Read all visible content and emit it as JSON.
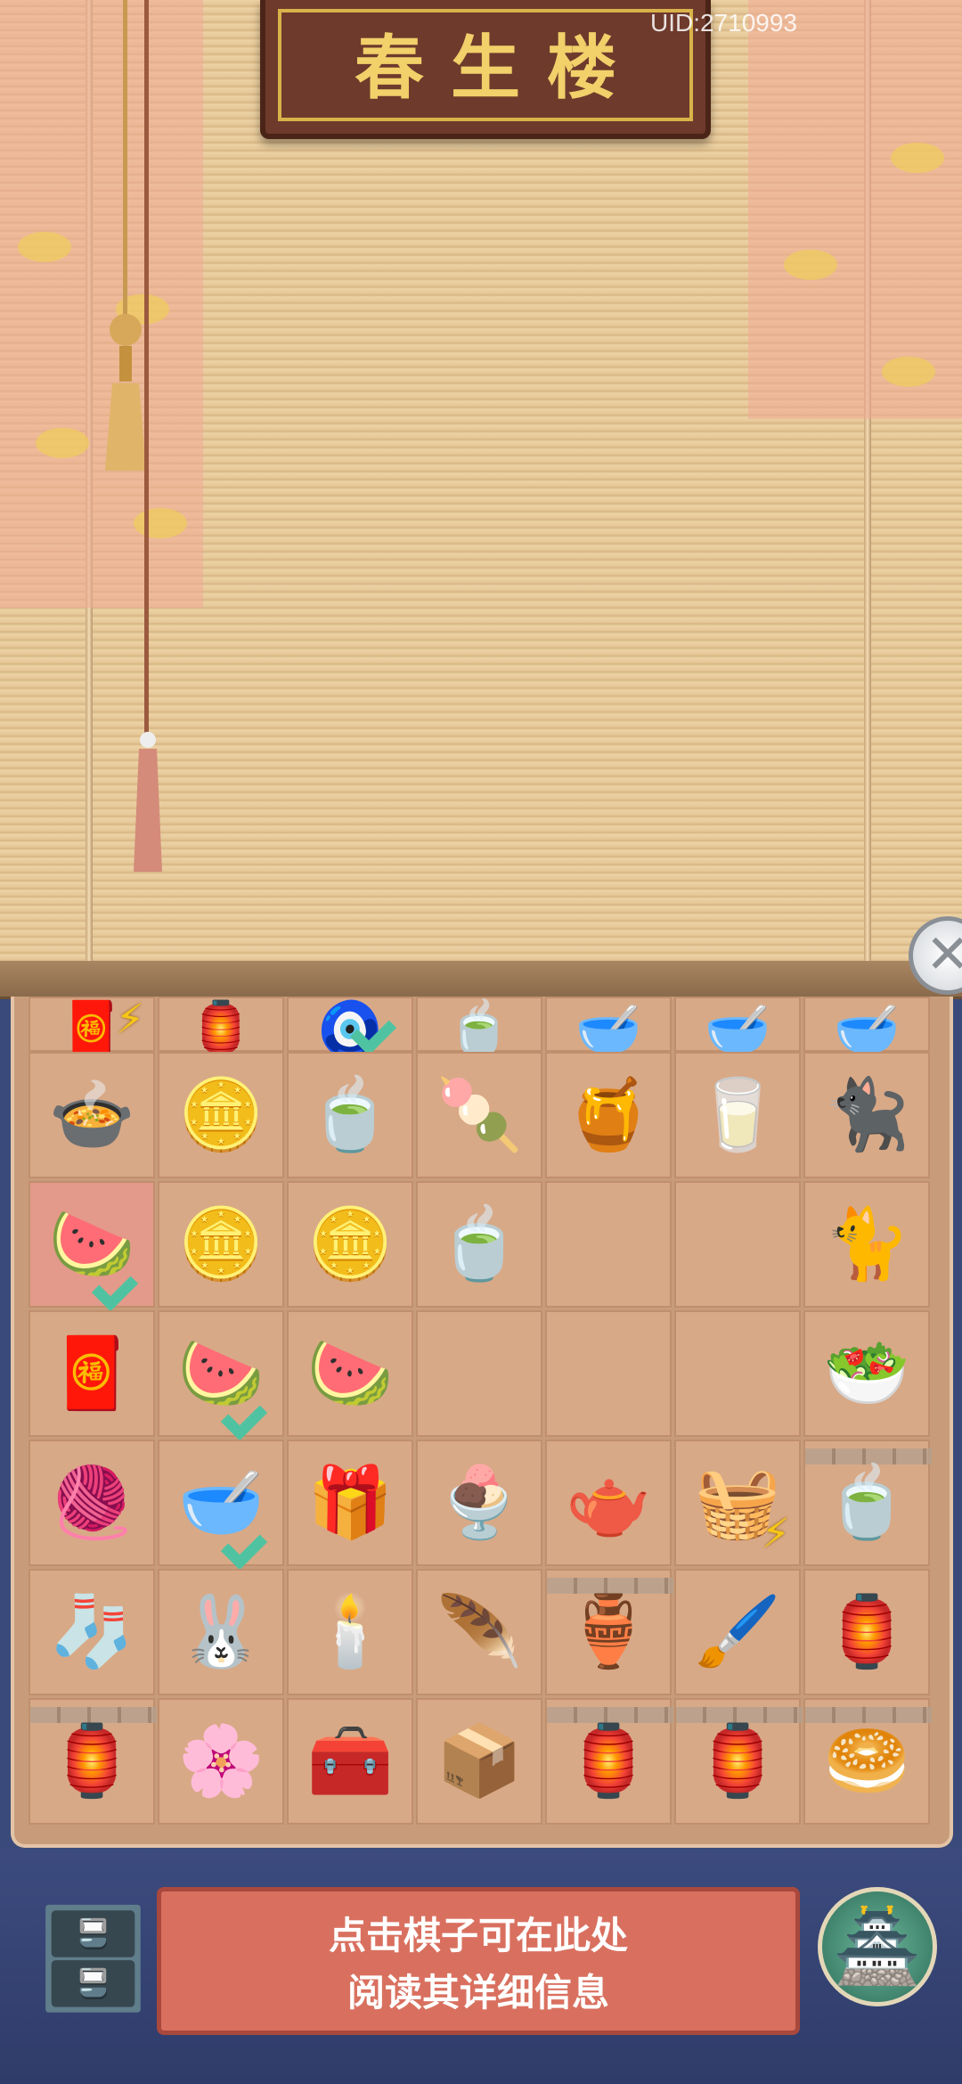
{
  "header": {
    "sign_title": "春生楼",
    "uid": "UID:2710993"
  },
  "icons": {
    "close": "close-x-icon",
    "storage": "cabinet-icon",
    "shop": "pavilion-icon"
  },
  "board": {
    "partial_row": [
      {
        "item": "🧧",
        "name": "partial-item-pouch",
        "bolt": true
      },
      {
        "item": "🏮",
        "name": "partial-item-lantern-purple"
      },
      {
        "item": "🧿",
        "name": "partial-item-ornament",
        "check": true
      },
      {
        "item": "🍵",
        "name": "partial-item-tray"
      },
      {
        "item": "🥣",
        "name": "partial-item-bowl-blue"
      },
      {
        "item": "🥣",
        "name": "partial-item-bowl-white"
      },
      {
        "item": "🥣",
        "name": "partial-item-bowl-green"
      }
    ],
    "rows": [
      [
        {
          "item": "🍲",
          "name": "red-bean-soup"
        },
        {
          "item": "🪙",
          "name": "coins-small"
        },
        {
          "item": "🍵",
          "name": "tea-cup-green"
        },
        {
          "item": "🍡",
          "name": "pink-pastry"
        },
        {
          "item": "🍯",
          "name": "porcelain-bowl"
        },
        {
          "item": "🥛",
          "name": "milk-bowl"
        },
        {
          "item": "🐈‍⬛",
          "name": "black-cat"
        }
      ],
      [
        {
          "item": "🍉",
          "name": "fruit-platter",
          "check": true,
          "hl": true
        },
        {
          "item": "🪙",
          "name": "coins-stack"
        },
        {
          "item": "🪙",
          "name": "coins-pair"
        },
        {
          "item": "🍵",
          "name": "tea-cup-blue"
        },
        {
          "item": "",
          "name": "empty-cell"
        },
        {
          "item": "",
          "name": "empty-cell"
        },
        {
          "item": "🐈",
          "name": "tabby-cat"
        }
      ],
      [
        {
          "item": "🧧",
          "name": "red-gems"
        },
        {
          "item": "🍉",
          "name": "fruit-plate",
          "check": true
        },
        {
          "item": "🍉",
          "name": "watermelon-slice"
        },
        {
          "item": "",
          "name": "empty-cell"
        },
        {
          "item": "",
          "name": "empty-cell"
        },
        {
          "item": "",
          "name": "empty-cell"
        },
        {
          "item": "🥗",
          "name": "mung-bean-soup"
        }
      ],
      [
        {
          "item": "🧶",
          "name": "silk-spindle"
        },
        {
          "item": "🥣",
          "name": "porridge-bowl",
          "check": true
        },
        {
          "item": "🎁",
          "name": "wooden-box"
        },
        {
          "item": "🍨",
          "name": "berry-pudding"
        },
        {
          "item": "🫖",
          "name": "blue-tea-jar"
        },
        {
          "item": "🧺",
          "name": "rice-bucket",
          "bolt": true
        },
        {
          "item": "🍵",
          "name": "tea-bowl-stand",
          "fence": true
        }
      ],
      [
        {
          "item": "🧦",
          "name": "silk-cocoons"
        },
        {
          "item": "🐰",
          "name": "bunny-peach-buns"
        },
        {
          "item": "🕯️",
          "name": "incense-burner"
        },
        {
          "item": "🪶",
          "name": "jade-feather"
        },
        {
          "item": "🏺",
          "name": "wicker-cage",
          "fence": true
        },
        {
          "item": "🖌️",
          "name": "brush-scroll"
        },
        {
          "item": "🏮",
          "name": "red-lantern"
        }
      ],
      [
        {
          "item": "🏮",
          "name": "wooden-lantern-1",
          "fence": true
        },
        {
          "item": "🌸",
          "name": "blue-hairpin"
        },
        {
          "item": "🧰",
          "name": "tool-box"
        },
        {
          "item": "📦",
          "name": "small-box"
        },
        {
          "item": "🏮",
          "name": "wooden-lantern-2",
          "fence": true
        },
        {
          "item": "🏮",
          "name": "wooden-lantern-3",
          "fence": true
        },
        {
          "item": "🥯",
          "name": "jade-ring",
          "fence": true
        }
      ]
    ]
  },
  "info_panel": {
    "text": "点击棋子可在此处\n阅读其详细信息"
  }
}
